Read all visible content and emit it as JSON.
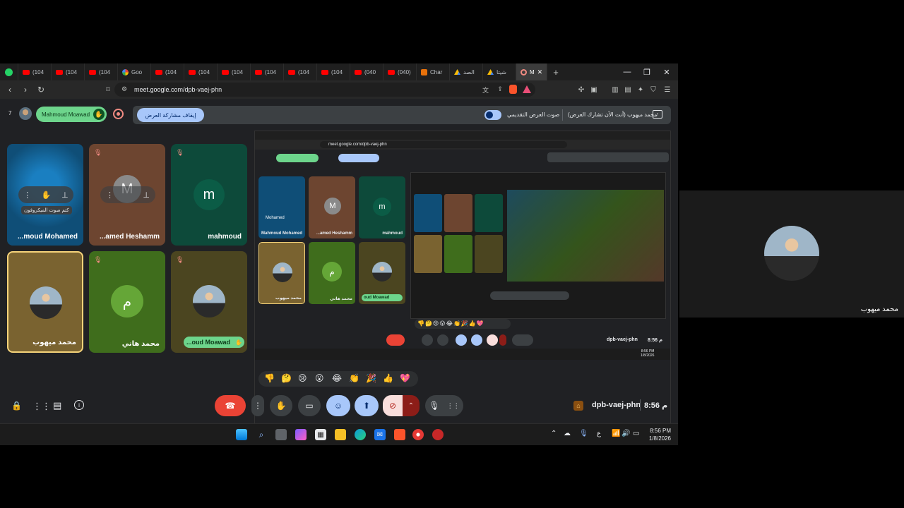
{
  "browser": {
    "tabs": [
      {
        "label": "",
        "icon": "whatsapp-icon"
      },
      {
        "label": "(104",
        "icon": "youtube-icon"
      },
      {
        "label": "(104",
        "icon": "youtube-icon"
      },
      {
        "label": "(104",
        "icon": "youtube-icon"
      },
      {
        "label": "Goo",
        "icon": "gemini-icon"
      },
      {
        "label": "(104",
        "icon": "youtube-icon"
      },
      {
        "label": "(104",
        "icon": "youtube-icon"
      },
      {
        "label": "(104",
        "icon": "youtube-icon"
      },
      {
        "label": "(104",
        "icon": "youtube-icon"
      },
      {
        "label": "(104",
        "icon": "youtube-icon"
      },
      {
        "label": "(104",
        "icon": "youtube-icon"
      },
      {
        "label": "(040",
        "icon": "youtube-icon"
      },
      {
        "label": "(040)",
        "icon": "youtube-icon"
      },
      {
        "label": "Char",
        "icon": "chat-icon"
      },
      {
        "label": "الصد",
        "icon": "drive-icon"
      },
      {
        "label": "شيتا",
        "icon": "drive-icon"
      },
      {
        "label": "M",
        "icon": "recording-icon"
      }
    ],
    "url": "meet.google.com/dpb-vaej-phn"
  },
  "meet": {
    "participant_count": "7",
    "hand_raised_name": "Mahmoud Moawad",
    "stop_sharing_label": "إيقاف مشاركة العرض",
    "presentation_audio_label": "صوت العرض التقديمي",
    "presenting_label": "محمد ميهوب (أنت الآن تشارك العرض)",
    "tiles": [
      {
        "name": "...moud Mohamed",
        "tooltip": "كتم صوت الميكروفون"
      },
      {
        "name": "...amed Heshamm",
        "initial": "M"
      },
      {
        "name": "mahmoud",
        "initial": "m"
      },
      {
        "name": "محمد ميهوب"
      },
      {
        "name": "محمد هاني",
        "initial": "م"
      },
      {
        "name": "...oud Moawad"
      }
    ],
    "meeting_code": "dpb-vaej-phn",
    "time": "8:56 م",
    "reactions": [
      "👎",
      "🤔",
      "😢",
      "😮",
      "😂",
      "👏",
      "🎉",
      "👍",
      "💖"
    ]
  },
  "nested": {
    "url": "meet.google.com/dpb-vaej-phn",
    "tooltip_name": "Mohamed",
    "tiles": [
      {
        "name": "Mahmoud Mohamed"
      },
      {
        "name": "...amed Heshamm",
        "initial": "M"
      },
      {
        "name": "mahmoud",
        "initial": "m"
      },
      {
        "name": "محمد ميهوب"
      },
      {
        "name": "محمد هاني",
        "initial": "م"
      },
      {
        "name": "oud Moawad"
      }
    ],
    "meeting_code": "dpb-vaej-phn",
    "time": "8:56 م",
    "clock_time": "8:56 PM",
    "clock_date": "1/8/2026"
  },
  "taskbar": {
    "input_lang": "ع",
    "clock_time": "8:56 PM",
    "clock_date": "1/8/2026"
  },
  "selfview": {
    "name": "محمد ميهوب"
  },
  "colors": {
    "meet_bg": "#202124",
    "accent_blue": "#a8c7fa",
    "hangup_red": "#ea4335",
    "hand_green": "#6dd58c"
  }
}
